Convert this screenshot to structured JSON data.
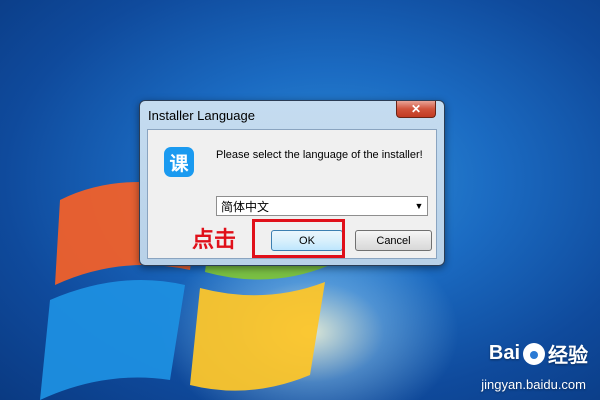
{
  "dialog": {
    "title": "Installer Language",
    "close_label": "✕",
    "app_icon_glyph": "课",
    "prompt": "Please select the language of the installer!",
    "language_selected": "简体中文",
    "ok_label": "OK",
    "cancel_label": "Cancel"
  },
  "annotation": {
    "label": "点击",
    "color": "#e0101a"
  },
  "watermark": {
    "brand_left": "Bai",
    "brand_right": "经验",
    "url": "jingyan.baidu.com"
  },
  "colors": {
    "desktop_blue": "#1b6bc2",
    "app_icon_blue": "#1a9af0",
    "close_red": "#c23a22"
  }
}
